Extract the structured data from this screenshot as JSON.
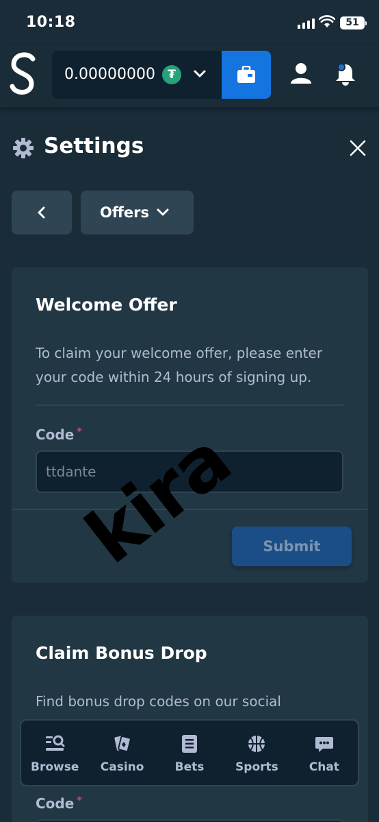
{
  "status_bar": {
    "time": "10:18",
    "battery": "51"
  },
  "header": {
    "balance": "0.00000000",
    "currency_symbol": "₮"
  },
  "settings": {
    "title": "Settings"
  },
  "nav": {
    "section_label": "Offers"
  },
  "welcome_offer": {
    "title": "Welcome Offer",
    "description": "To claim your welcome offer, please enter your code within 24 hours of signing up.",
    "code_label": "Code",
    "required_mark": "*",
    "code_placeholder": "ttdante",
    "submit_label": "Submit"
  },
  "bonus_drop": {
    "title": "Claim Bonus Drop",
    "description": "Find bonus drop codes on our social",
    "code_label": "Code",
    "required_mark": "*"
  },
  "bottom_nav": {
    "items": [
      {
        "label": "Browse",
        "icon": "browse-icon"
      },
      {
        "label": "Casino",
        "icon": "casino-cards-icon"
      },
      {
        "label": "Bets",
        "icon": "bets-list-icon"
      },
      {
        "label": "Sports",
        "icon": "basketball-icon"
      },
      {
        "label": "Chat",
        "icon": "chat-bubble-icon"
      }
    ]
  },
  "watermark": "kira",
  "colors": {
    "background": "#1a2c38",
    "card": "#213743",
    "button": "#2f4553",
    "accent_blue": "#1475e1",
    "tether_green": "#26a17b"
  }
}
